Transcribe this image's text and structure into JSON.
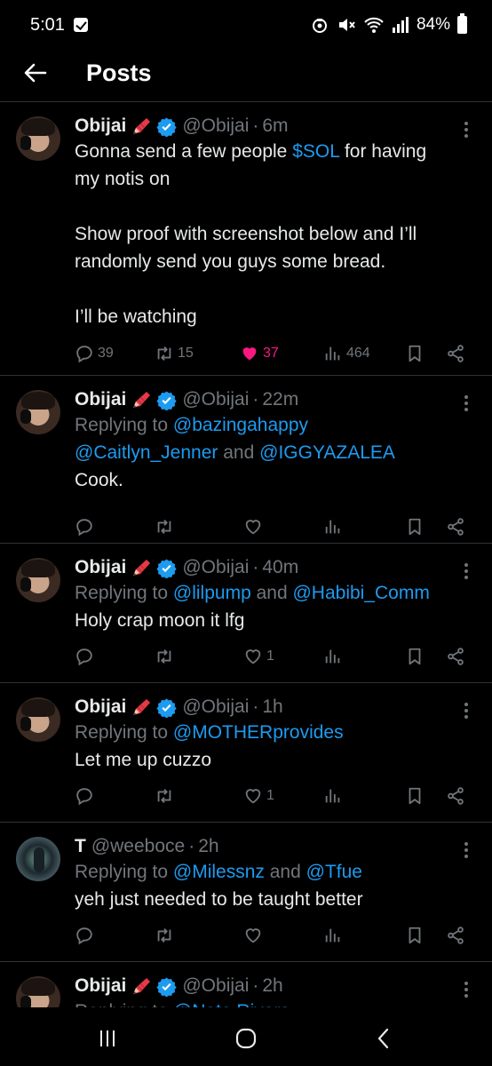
{
  "status": {
    "time": "5:01",
    "battery": "84%"
  },
  "header": {
    "title": "Posts"
  },
  "posts": [
    {
      "name": "Obijai",
      "handle": "@Obijai",
      "time": "6m",
      "text_a": "Gonna send a few people ",
      "text_link": "$SOL",
      "text_b": " for having\nmy notis on\n\nShow proof with screenshot below and I’ll\nrandomly send you guys some bread.\n\nI’ll be watching",
      "replies": "39",
      "reposts": "15",
      "likes": "37",
      "views": "464"
    },
    {
      "name": "Obijai",
      "handle": "@Obijai",
      "time": "22m",
      "replying_prefix": "Replying to ",
      "reply_link1": "@bazingahappy",
      "reply_link2": "@Caitlyn_Jenner",
      "reply_and": " and ",
      "reply_link3": "@IGGYAZALEA",
      "text": "Cook."
    },
    {
      "name": "Obijai",
      "handle": "@Obijai",
      "time": "40m",
      "replying_prefix": "Replying to ",
      "reply_link1": "@lilpump",
      "reply_and": " and ",
      "reply_link2": "@Habibi_Comm",
      "text": "Holy crap moon it lfg",
      "likes": "1"
    },
    {
      "name": "Obijai",
      "handle": "@Obijai",
      "time": "1h",
      "replying_prefix": "Replying to ",
      "reply_link1": "@MOTHERprovides",
      "text": "Let me up cuzzo",
      "likes": "1"
    },
    {
      "name": "T",
      "handle": "@weeboce",
      "time": "2h",
      "replying_prefix": "Replying to ",
      "reply_link1": "@Milessnz",
      "reply_and": " and ",
      "reply_link2": "@Tfue",
      "text": "yeh just needed to be taught better"
    },
    {
      "name": "Obijai",
      "handle": "@Obijai",
      "time": "2h",
      "replying_prefix": "Replying to ",
      "reply_link1": "@Nate Rivers"
    }
  ],
  "colors": {
    "accent": "#1d9bf0",
    "like": "#f91880",
    "muted": "#71767b",
    "verified": "#1d9bf0"
  }
}
